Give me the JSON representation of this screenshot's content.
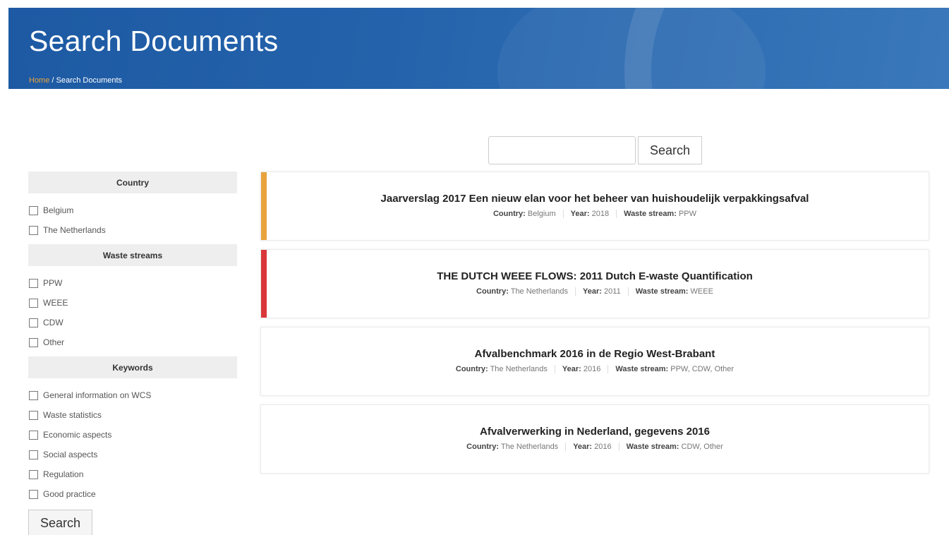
{
  "header": {
    "title": "Search Documents",
    "breadcrumb": {
      "home": "Home",
      "separator": " / ",
      "current": "Search Documents"
    }
  },
  "search": {
    "value": "",
    "placeholder": "",
    "button_label": "Search"
  },
  "sidebar": {
    "groups": [
      {
        "heading": "Country",
        "options": [
          "Belgium",
          "The Netherlands"
        ]
      },
      {
        "heading": "Waste streams",
        "options": [
          "PPW",
          "WEEE",
          "CDW",
          "Other"
        ]
      },
      {
        "heading": "Keywords",
        "options": [
          "General information on WCS",
          "Waste statistics",
          "Economic aspects",
          "Social aspects",
          "Regulation",
          "Good practice"
        ]
      }
    ],
    "search_button_label": "Search"
  },
  "meta_labels": {
    "country": "Country:",
    "year": "Year:",
    "waste_stream": "Waste stream:"
  },
  "results": [
    {
      "title": "Jaarverslag 2017 Een nieuw elan voor het beheer van huishoudelijk verpakkingsafval",
      "country": "Belgium",
      "year": "2018",
      "waste_stream": "PPW",
      "accent_color": "#e8a33d"
    },
    {
      "title": "THE DUTCH WEEE FLOWS: 2011 Dutch E-waste Quantification",
      "country": "The Netherlands",
      "year": "2011",
      "waste_stream": "WEEE",
      "accent_color": "#d9373a"
    },
    {
      "title": "Afvalbenchmark 2016 in de Regio West-Brabant",
      "country": "The Netherlands",
      "year": "2016",
      "waste_stream": "PPW, CDW, Other",
      "accent_color": ""
    },
    {
      "title": "Afvalverwerking in Nederland, gegevens 2016",
      "country": "The Netherlands",
      "year": "2016",
      "waste_stream": "CDW, Other",
      "accent_color": ""
    }
  ],
  "colors": {
    "banner": "#2462ab",
    "breadcrumb_link": "#e8a33d"
  }
}
